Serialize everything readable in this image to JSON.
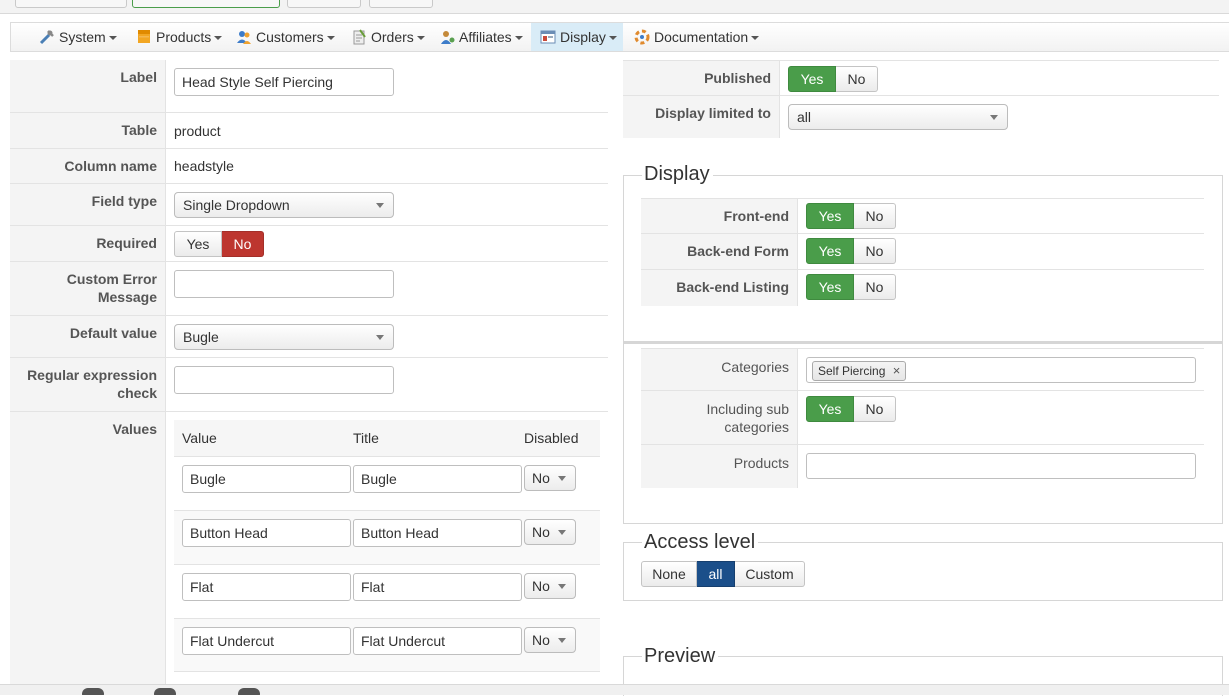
{
  "menu": {
    "items": [
      {
        "label": "System",
        "icon": "tools-icon"
      },
      {
        "label": "Products",
        "icon": "products-icon"
      },
      {
        "label": "Customers",
        "icon": "customers-icon"
      },
      {
        "label": "Orders",
        "icon": "orders-icon"
      },
      {
        "label": "Affiliates",
        "icon": "affiliates-icon"
      },
      {
        "label": "Display",
        "icon": "display-icon",
        "active": true
      },
      {
        "label": "Documentation",
        "icon": "documentation-icon"
      }
    ]
  },
  "form": {
    "label": {
      "label": "Label",
      "value": "Head Style Self Piercing"
    },
    "table": {
      "label": "Table",
      "value": "product"
    },
    "column": {
      "label": "Column name",
      "value": "headstyle"
    },
    "field_type": {
      "label": "Field type",
      "value": "Single Dropdown"
    },
    "required": {
      "label": "Required",
      "yes": "Yes",
      "no": "No",
      "selected": "No"
    },
    "custom_error": {
      "label_line1": "Custom Error",
      "label_line2": "Message",
      "value": ""
    },
    "default_value": {
      "label": "Default value",
      "value": "Bugle"
    },
    "regex": {
      "label_line1": "Regular expression",
      "label_line2": "check",
      "value": ""
    },
    "values": {
      "label": "Values",
      "headers": {
        "value": "Value",
        "title": "Title",
        "disabled": "Disabled"
      },
      "rows": [
        {
          "value": "Bugle",
          "title": "Bugle",
          "disabled": "No"
        },
        {
          "value": "Button Head",
          "title": "Button Head",
          "disabled": "No"
        },
        {
          "value": "Flat",
          "title": "Flat",
          "disabled": "No"
        },
        {
          "value": "Flat Undercut",
          "title": "Flat Undercut",
          "disabled": "No"
        }
      ]
    }
  },
  "right": {
    "published": {
      "label": "Published",
      "yes": "Yes",
      "no": "No",
      "selected": "Yes"
    },
    "display_limited": {
      "label": "Display limited to",
      "value": "all"
    },
    "display_section": {
      "legend": "Display",
      "frontend": {
        "label": "Front-end",
        "yes": "Yes",
        "no": "No"
      },
      "backend_form": {
        "label": "Back-end Form",
        "yes": "Yes",
        "no": "No"
      },
      "backend_listing": {
        "label": "Back-end Listing",
        "yes": "Yes",
        "no": "No"
      }
    },
    "categories_section": {
      "categories": {
        "label": "Categories",
        "tag": "Self Piercing",
        "tag_remove": "×"
      },
      "including_sub": {
        "label_line1": "Including sub",
        "label_line2": "categories",
        "yes": "Yes",
        "no": "No"
      },
      "products": {
        "label": "Products",
        "value": ""
      }
    },
    "access_level": {
      "legend": "Access level",
      "none": "None",
      "all": "all",
      "custom": "Custom",
      "selected": "all"
    },
    "preview": {
      "legend": "Preview"
    }
  }
}
